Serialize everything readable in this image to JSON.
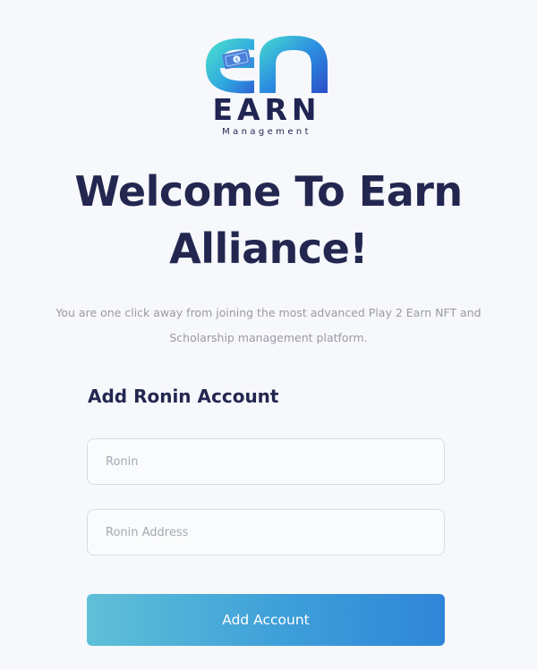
{
  "logo": {
    "word": "EARN",
    "sub": "Management",
    "icon": "earn-logo-mark"
  },
  "colors": {
    "background": "#f7f8fb",
    "heading": "#232750",
    "body_text": "#9a9aa6",
    "logo_teal": "#3fd6c6",
    "logo_blue": "#2b6fd6",
    "button_gradient_start": "#5fc0d8",
    "button_gradient_end": "#2f86d8"
  },
  "welcome": {
    "title": "Welcome To Earn Alliance!",
    "subtitle": "You are one click away from joining the most advanced Play 2 Earn NFT and Scholarship management platform."
  },
  "form": {
    "heading": "Add Ronin Account",
    "ronin_field": {
      "placeholder": "Ronin",
      "value": ""
    },
    "address_field": {
      "placeholder": "Ronin Address",
      "value": ""
    },
    "submit_label": "Add Account"
  }
}
